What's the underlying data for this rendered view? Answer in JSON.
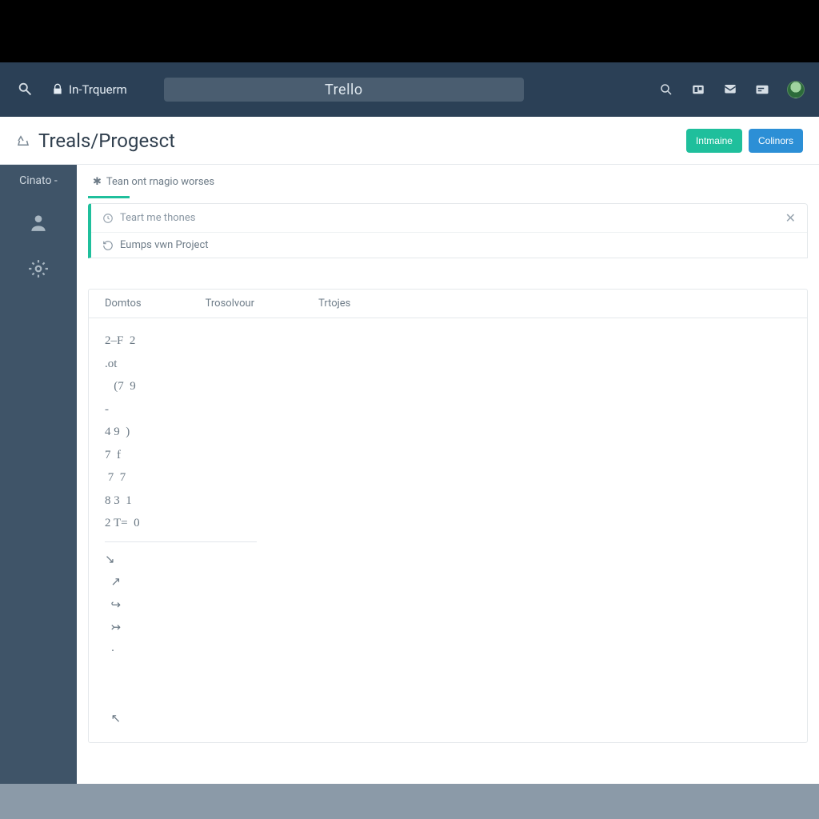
{
  "topbar": {
    "brand_text": "In-Trquerm",
    "search_center_label": "Trello"
  },
  "subhead": {
    "breadcrumb_text": "Treals/Progesct",
    "button_primary": "Intmaine",
    "button_secondary": "Colinors"
  },
  "sidebar": {
    "label": "Cinato -"
  },
  "crumb2": {
    "text": "Tean ont rnagio worses"
  },
  "notice": {
    "row1_text": "Teart me thones",
    "row2_text": "Eumps vwn Project"
  },
  "panel": {
    "col1": "Domtos",
    "col2": "Trosolvour",
    "col3": "Trtojes",
    "scribble_lines": "2–F  2\n.ot\n   (7  9\n-\n4 9  )\n7  f\n 7  7\n8 3  1\n2 T=  0",
    "scribble_tail": "↘\n  ↗\n  ↪\n  ↣\n  ·\n\n\n  ↖"
  }
}
